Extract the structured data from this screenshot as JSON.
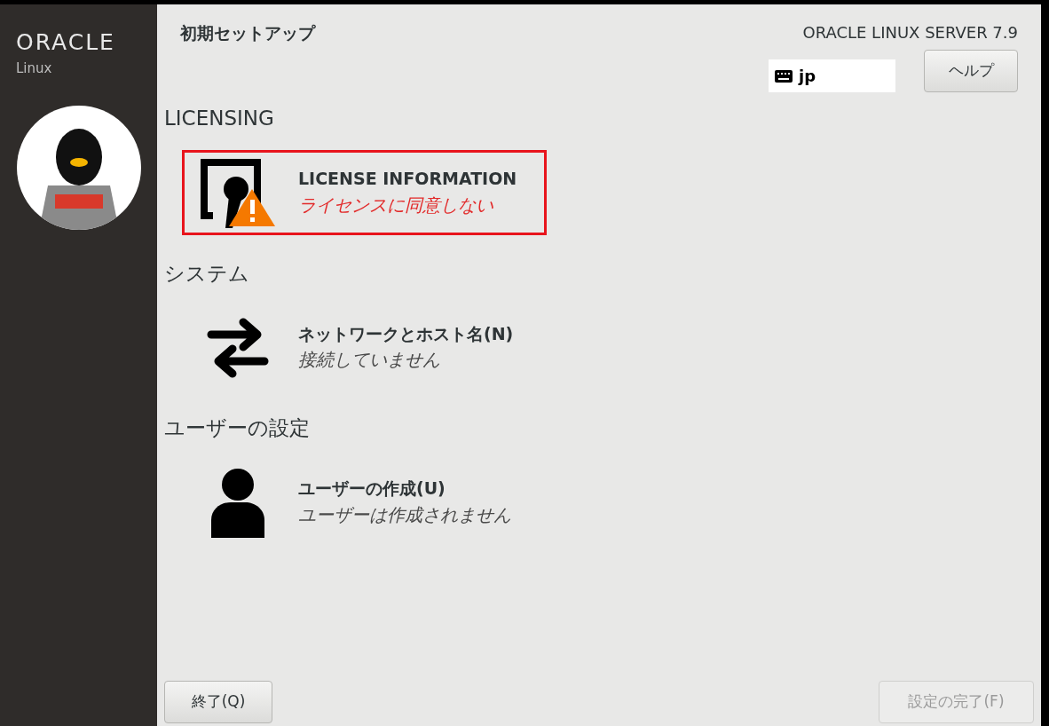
{
  "sidebar": {
    "logo": {
      "brand": "ORACLE",
      "product": "Linux"
    }
  },
  "header": {
    "title": "初期セットアップ",
    "product": "ORACLE LINUX SERVER 7.9",
    "keyboard": {
      "value": "jp"
    },
    "help_button": "ヘルプ"
  },
  "sections": [
    {
      "title": "LICENSING",
      "items": [
        {
          "kind": "license",
          "title": "LICENSE INFORMATION",
          "status": "ライセンスに同意しない",
          "warning": true,
          "highlighted": true
        }
      ]
    },
    {
      "title": "システム",
      "items": [
        {
          "kind": "network",
          "title": "ネットワークとホスト名(N)",
          "status": "接続していません",
          "warning": false,
          "highlighted": false
        }
      ]
    },
    {
      "title": "ユーザーの設定",
      "items": [
        {
          "kind": "user",
          "title": "ユーザーの作成(U)",
          "status": "ユーザーは作成されません",
          "warning": false,
          "highlighted": false
        }
      ]
    }
  ],
  "footer": {
    "quit_button": {
      "label": "終了(Q)",
      "disabled": false
    },
    "finish_button": {
      "label": "設定の完了(F)",
      "disabled": true
    }
  }
}
